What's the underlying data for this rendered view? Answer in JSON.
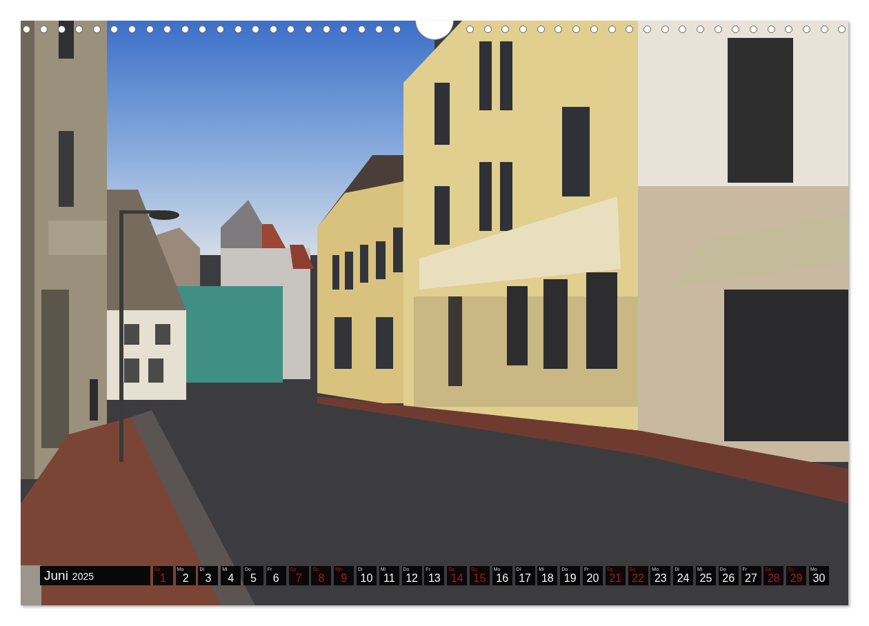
{
  "calendar": {
    "month": "Juni",
    "year": "2025",
    "days": [
      {
        "weekday": "So",
        "day": "1",
        "day_off": true
      },
      {
        "weekday": "Mo",
        "day": "2",
        "day_off": false
      },
      {
        "weekday": "Di",
        "day": "3",
        "day_off": false
      },
      {
        "weekday": "Mi",
        "day": "4",
        "day_off": false
      },
      {
        "weekday": "Do",
        "day": "5",
        "day_off": false
      },
      {
        "weekday": "Fr",
        "day": "6",
        "day_off": false
      },
      {
        "weekday": "Sa",
        "day": "7",
        "day_off": true
      },
      {
        "weekday": "So",
        "day": "8",
        "day_off": true
      },
      {
        "weekday": "Mo",
        "day": "9",
        "day_off": true
      },
      {
        "weekday": "Di",
        "day": "10",
        "day_off": false
      },
      {
        "weekday": "Mi",
        "day": "11",
        "day_off": false
      },
      {
        "weekday": "Do",
        "day": "12",
        "day_off": false
      },
      {
        "weekday": "Fr",
        "day": "13",
        "day_off": false
      },
      {
        "weekday": "Sa",
        "day": "14",
        "day_off": true
      },
      {
        "weekday": "So",
        "day": "15",
        "day_off": true
      },
      {
        "weekday": "Mo",
        "day": "16",
        "day_off": false
      },
      {
        "weekday": "Di",
        "day": "17",
        "day_off": false
      },
      {
        "weekday": "Mi",
        "day": "18",
        "day_off": false
      },
      {
        "weekday": "Do",
        "day": "19",
        "day_off": false
      },
      {
        "weekday": "Fr",
        "day": "20",
        "day_off": false
      },
      {
        "weekday": "Sa",
        "day": "21",
        "day_off": true
      },
      {
        "weekday": "So",
        "day": "22",
        "day_off": true
      },
      {
        "weekday": "Mo",
        "day": "23",
        "day_off": false
      },
      {
        "weekday": "Di",
        "day": "24",
        "day_off": false
      },
      {
        "weekday": "Mi",
        "day": "25",
        "day_off": false
      },
      {
        "weekday": "Do",
        "day": "26",
        "day_off": false
      },
      {
        "weekday": "Fr",
        "day": "27",
        "day_off": false
      },
      {
        "weekday": "Sa",
        "day": "28",
        "day_off": true
      },
      {
        "weekday": "So",
        "day": "29",
        "day_off": true
      },
      {
        "weekday": "Mo",
        "day": "30",
        "day_off": false
      }
    ]
  }
}
